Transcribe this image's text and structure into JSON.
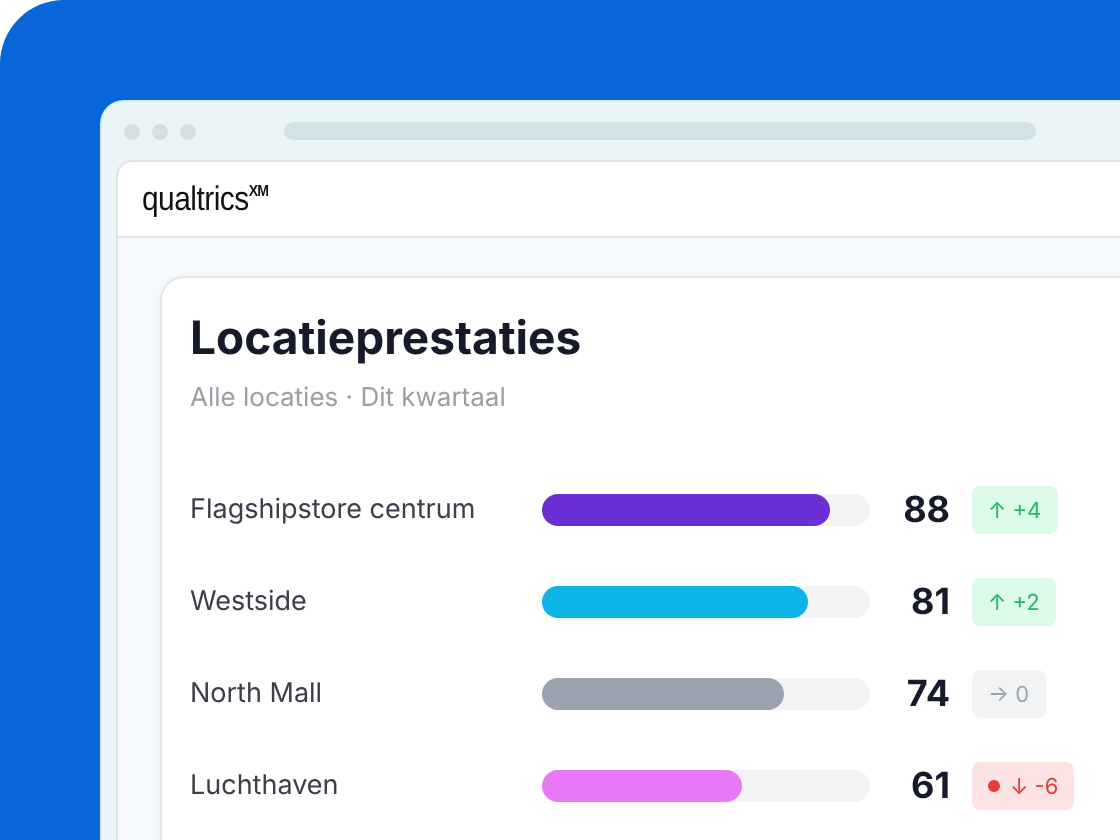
{
  "app": {
    "logo": "qualtrics",
    "logo_mark": "XM"
  },
  "card": {
    "title": "Locatieprestaties",
    "subtitle": "Alle locaties · Dit kwartaal",
    "rows": [
      {
        "name": "Flagshipstore centrum",
        "level": 0.88,
        "color": "#6b2fd6",
        "score": "88",
        "delta": {
          "kind": "up",
          "text": "↑ +4"
        }
      },
      {
        "name": "Westside",
        "level": 0.81,
        "color": "#0cb4e8",
        "score": "81",
        "delta": {
          "kind": "up",
          "text": "↑ +2"
        }
      },
      {
        "name": "North Mall",
        "level": 0.74,
        "color": "#9ca3af",
        "score": "74",
        "delta": {
          "kind": "flat",
          "text": "→ 0"
        }
      },
      {
        "name": "Luchthaven",
        "level": 0.61,
        "color": "#e879f9",
        "score": "61",
        "delta": {
          "kind": "down",
          "text": "↓ -6"
        }
      }
    ]
  }
}
